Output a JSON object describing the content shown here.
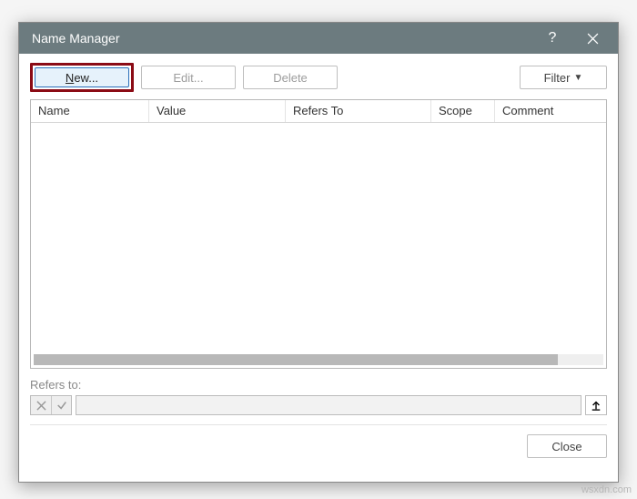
{
  "titlebar": {
    "title": "Name Manager",
    "help_icon": "?",
    "close_icon": "×"
  },
  "toolbar": {
    "new_label": "ew...",
    "edit_label": "Edit...",
    "delete_label": "Delete",
    "filter_label": "Filter"
  },
  "columns": {
    "name": "Name",
    "value": "Value",
    "refers_to": "Refers To",
    "scope": "Scope",
    "comment": "Comment"
  },
  "refers": {
    "label": "Refers to:",
    "value": ""
  },
  "close": {
    "label": "Close"
  },
  "watermark": "wsxdn.com"
}
